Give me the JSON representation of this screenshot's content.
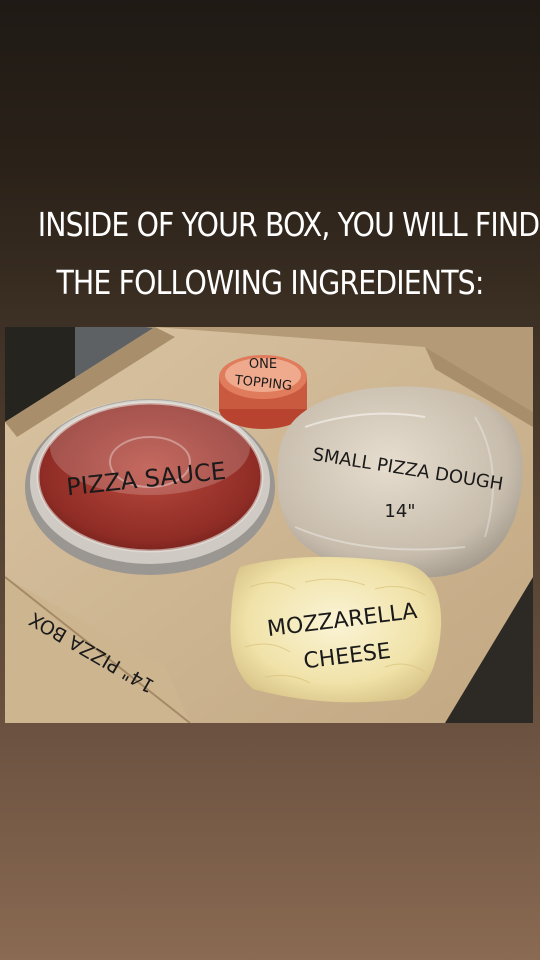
{
  "headline": {
    "line1": "INSIDE OF YOUR BOX, YOU WILL FIND",
    "line2": "THE FOLLOWING INGREDIENTS:"
  },
  "photo": {
    "labels": {
      "topping_line1": "ONE",
      "topping_line2": "TOPPING",
      "sauce": "PIZZA SAUCE",
      "dough_line1": "SMALL PIZZA DOUGH",
      "dough_line2": "14\"",
      "cheese_line1": "MOZZARELLA",
      "cheese_line2": "CHEESE",
      "box": "14\" PIZZA BOX"
    }
  }
}
